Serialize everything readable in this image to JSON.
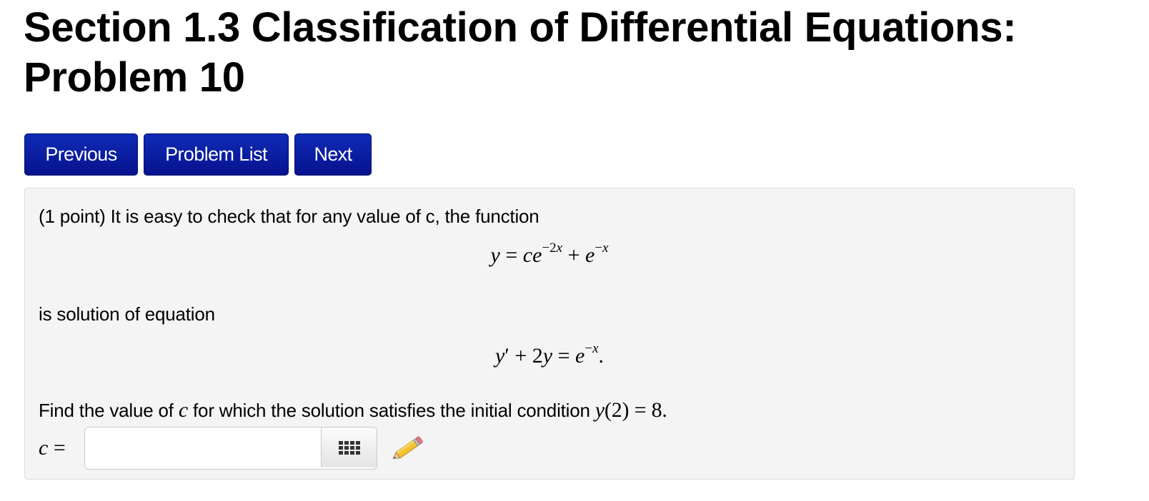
{
  "page": {
    "title": "Section 1.3 Classification of Differential Equations: Problem 10"
  },
  "nav": {
    "previous_label": "Previous",
    "problem_list_label": "Problem List",
    "next_label": "Next"
  },
  "problem": {
    "intro_text": "(1 point) It is easy to check that for any value of c, the function",
    "function_equation": "y = ce^{−2x} + e^{−x}",
    "middle_text": "is solution of equation",
    "differential_equation": "y′ + 2y = e^{−x}.",
    "question_prefix": "Find the value of",
    "question_variable": "c",
    "question_suffix": "for which the solution satisfies the initial condition",
    "initial_condition": "y(2) = 8.",
    "answer_label": "c =",
    "answer_value": ""
  },
  "icons": {
    "equation_palette": "grid-icon",
    "edit": "pencil-icon"
  },
  "colors": {
    "button_primary": "#06128e",
    "problem_background": "#f4f4f4"
  }
}
